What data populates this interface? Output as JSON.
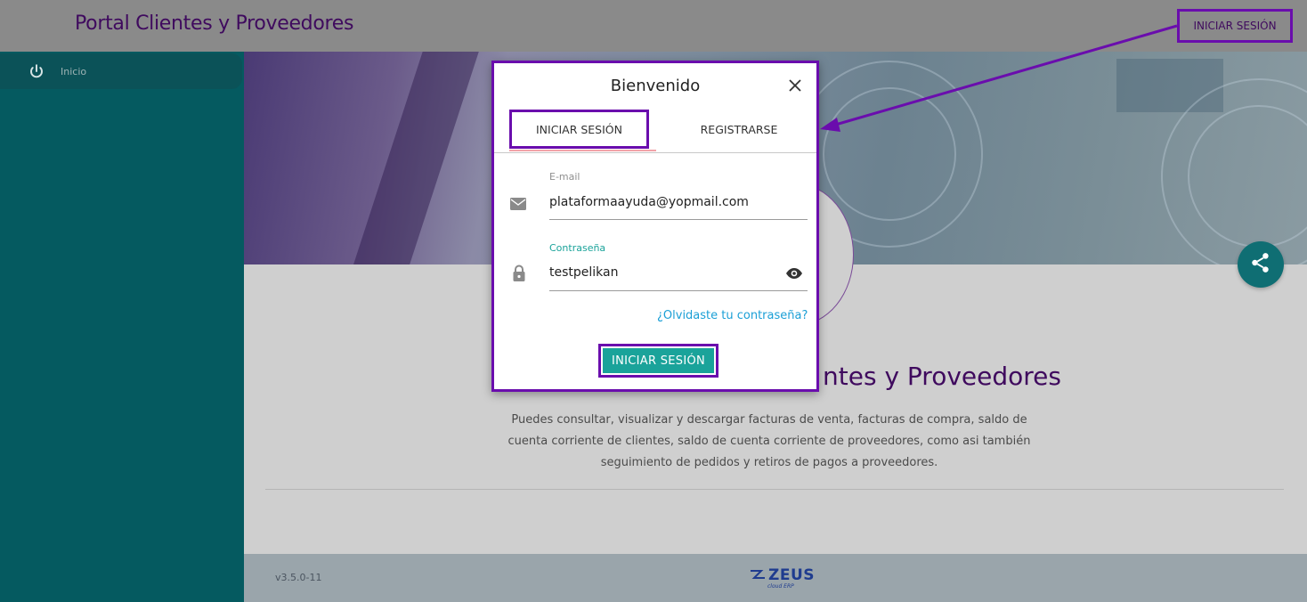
{
  "header": {
    "brand": "Portal Clientes y Proveedores",
    "login_button": "INICIAR SESIÓN"
  },
  "sidebar": {
    "items": [
      {
        "icon": "power-icon",
        "label": "Inicio"
      }
    ]
  },
  "main": {
    "headline": "ntes y Proveedores",
    "description": "Puedes consultar, visualizar y descargar facturas de venta, facturas de compra, saldo de cuenta corriente de clientes, saldo de cuenta corriente de proveedores, como asi también seguimiento de pedidos y retiros de pagos a proveedores.",
    "share_icon": "share-icon"
  },
  "footer": {
    "version": "v3.5.0-11",
    "logo_text": "ZEUS",
    "logo_sub": "cloud ERP"
  },
  "dialog": {
    "title": "Bienvenido",
    "tabs": [
      {
        "label": "INICIAR SESIÓN",
        "active": true
      },
      {
        "label": "REGISTRARSE",
        "active": false
      }
    ],
    "email": {
      "label": "E-mail",
      "value": "plataformaayuda@yopmail.com"
    },
    "password": {
      "label": "Contraseña",
      "value": "testpelikan"
    },
    "forgot_link": "¿Olvidaste tu contraseña?",
    "submit_label": "INICIAR SESIÓN"
  },
  "colors": {
    "brand_purple": "#3f0a5e",
    "highlight_purple": "#6a0dad",
    "teal_primary": "#1aa39a",
    "sidebar_teal": "#055a60",
    "link_blue": "#1a9fd6"
  }
}
